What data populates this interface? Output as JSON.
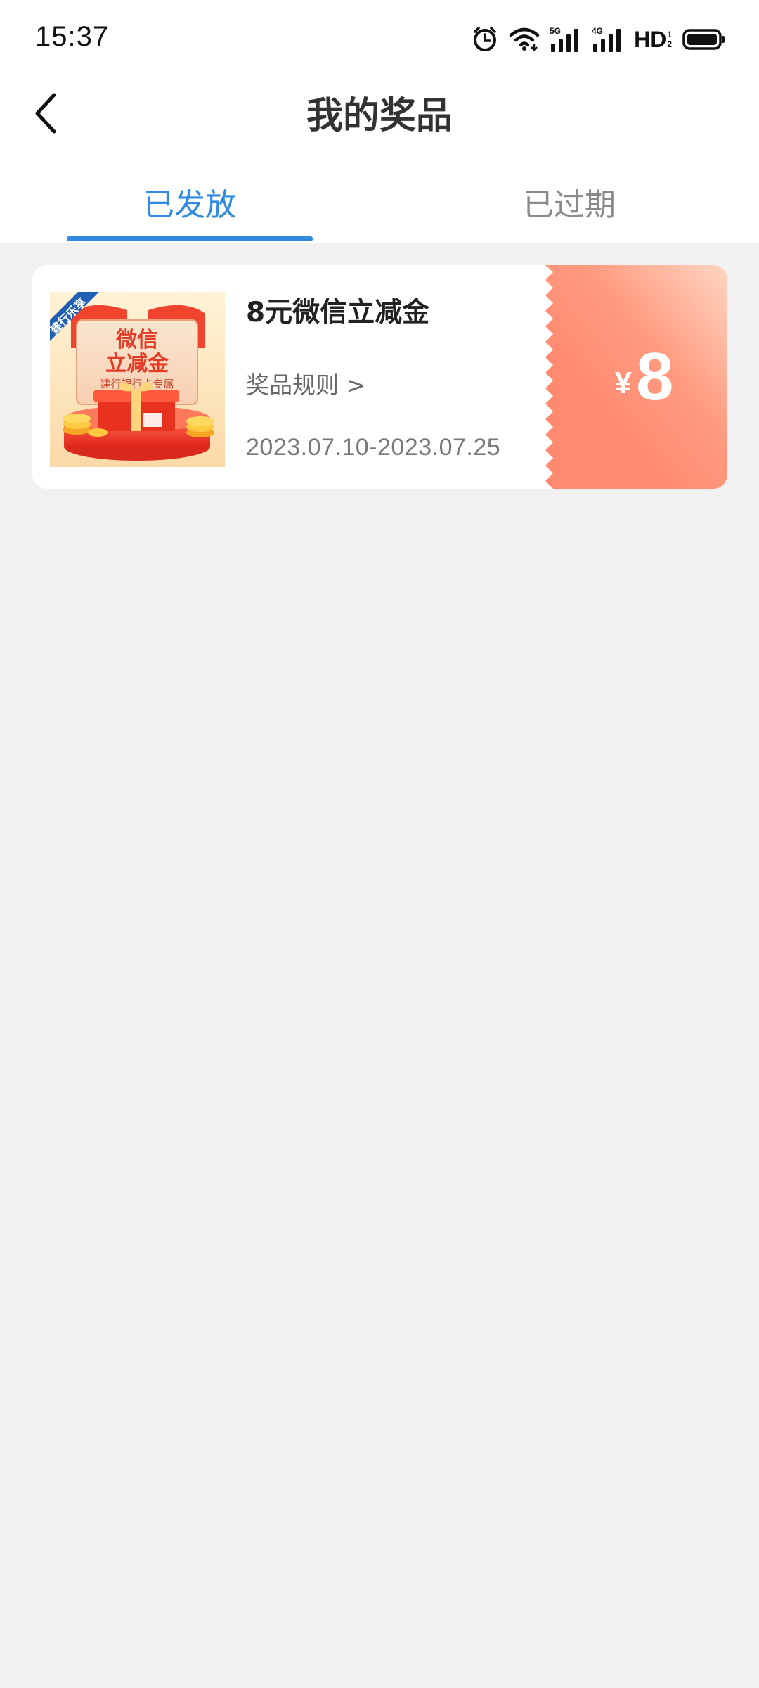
{
  "status_bar": {
    "time": "15:37",
    "icons": [
      "alarm-icon",
      "wifi-icon",
      "signal-5g-icon",
      "signal-4g-icon",
      "hd-icon",
      "battery-icon"
    ],
    "signal_5g_label": "5G",
    "signal_4g_label": "4G",
    "hd_label": "HD",
    "hd_sub_1": "1",
    "hd_sub_2": "2"
  },
  "header": {
    "title": "我的奖品",
    "back_icon": "chevron-left-icon"
  },
  "tabs": [
    {
      "label": "已发放",
      "active": true
    },
    {
      "label": "已过期",
      "active": false
    }
  ],
  "prizes": [
    {
      "title": "8元微信立减金",
      "rules_label": "奖品规则 >",
      "validity": "2023.07.10-2023.07.25",
      "currency_symbol": "¥",
      "amount": "8",
      "image": {
        "ribbon": "建行乐享",
        "line1": "微信",
        "line2": "立减金",
        "line3": "建行银行卡专属"
      }
    }
  ],
  "colors": {
    "accent": "#2f8ae0",
    "coupon_start": "#ffd3c0",
    "coupon_end": "#ff8a72",
    "background": "#f1f1f1"
  }
}
